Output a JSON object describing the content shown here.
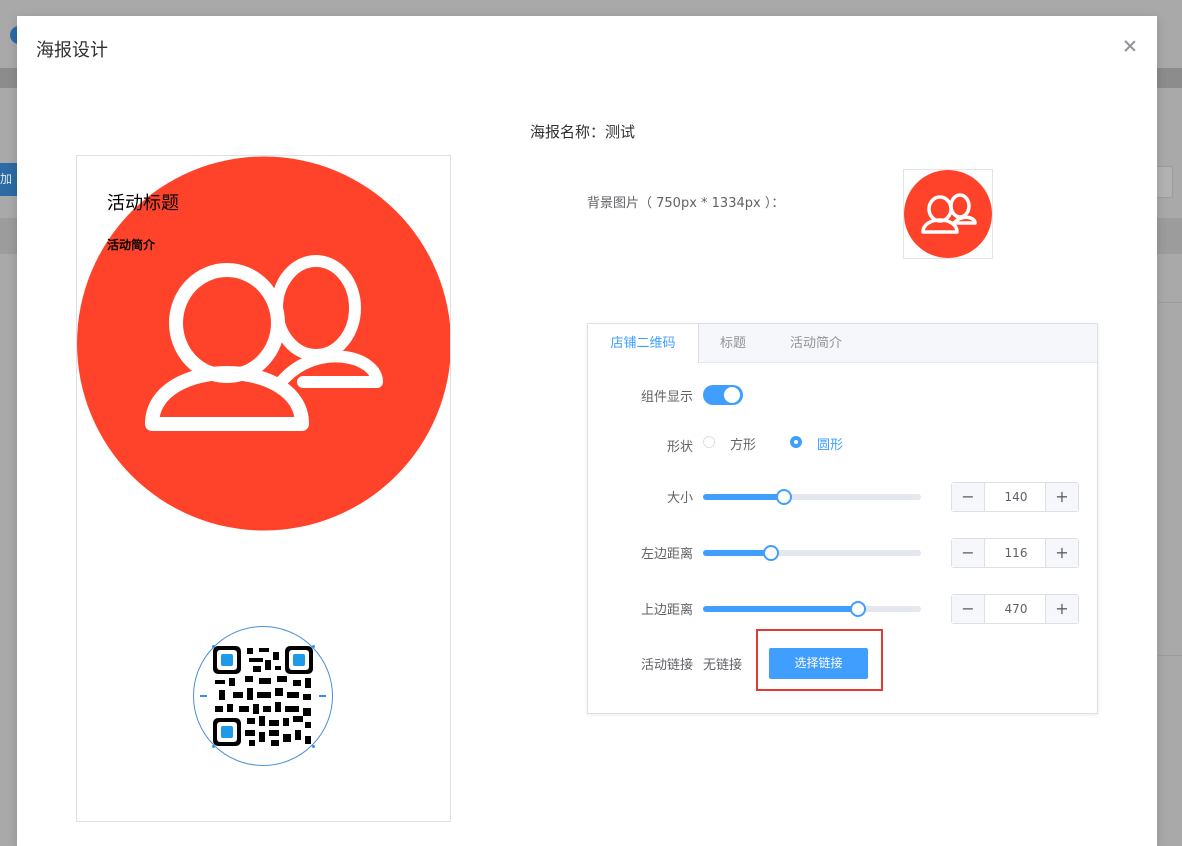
{
  "background": {
    "add_label": "加"
  },
  "dialog": {
    "title": "海报设计"
  },
  "poster": {
    "title": "活动标题",
    "description": "活动简介"
  },
  "info": {
    "poster_name": "海报名称：测试",
    "bg_image_label": "背景图片（ 750px * 1334px ）："
  },
  "tabs": [
    {
      "label": "店铺二维码",
      "active": true
    },
    {
      "label": "标题",
      "active": false
    },
    {
      "label": "活动简介",
      "active": false
    }
  ],
  "form": {
    "display_label": "组件显示",
    "display_on": true,
    "shape_label": "形状",
    "shape_options": [
      "方形",
      "圆形"
    ],
    "shape_selected": "圆形",
    "size": {
      "label": "大小",
      "value": "140",
      "fraction": 0.37
    },
    "left": {
      "label": "左边距离",
      "value": "116",
      "fraction": 0.31
    },
    "top": {
      "label": "上边距离",
      "value": "470",
      "fraction": 0.71
    },
    "link_label": "活动链接",
    "link_value": "无链接",
    "select_link_button": "选择链接"
  },
  "stepper": {
    "minus": "−",
    "plus": "+"
  },
  "colors": {
    "accent": "#409eff",
    "poster_red": "#ff432a",
    "highlight": "#e53935"
  }
}
